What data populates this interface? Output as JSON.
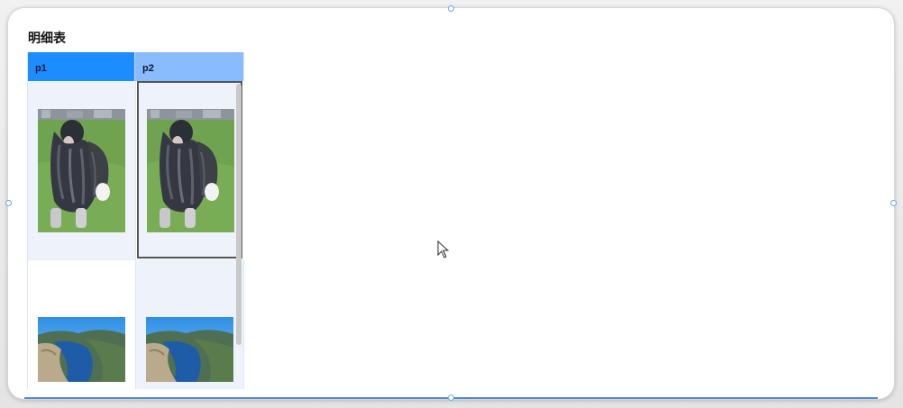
{
  "panel": {
    "title": "明细表"
  },
  "table": {
    "columns": [
      {
        "label": "p1"
      },
      {
        "label": "p2"
      }
    ],
    "rows": [
      {
        "p1": "dog-photo",
        "p2": "dog-photo"
      },
      {
        "p1": "fjord-landscape-photo",
        "p2": "fjord-landscape-photo"
      }
    ],
    "selected_cell": "row1-p2"
  },
  "colors": {
    "header_p1": "#1c8cff",
    "header_p2": "#88bbff",
    "row_shade": "#edf2fb",
    "selection_border": "#555555"
  }
}
